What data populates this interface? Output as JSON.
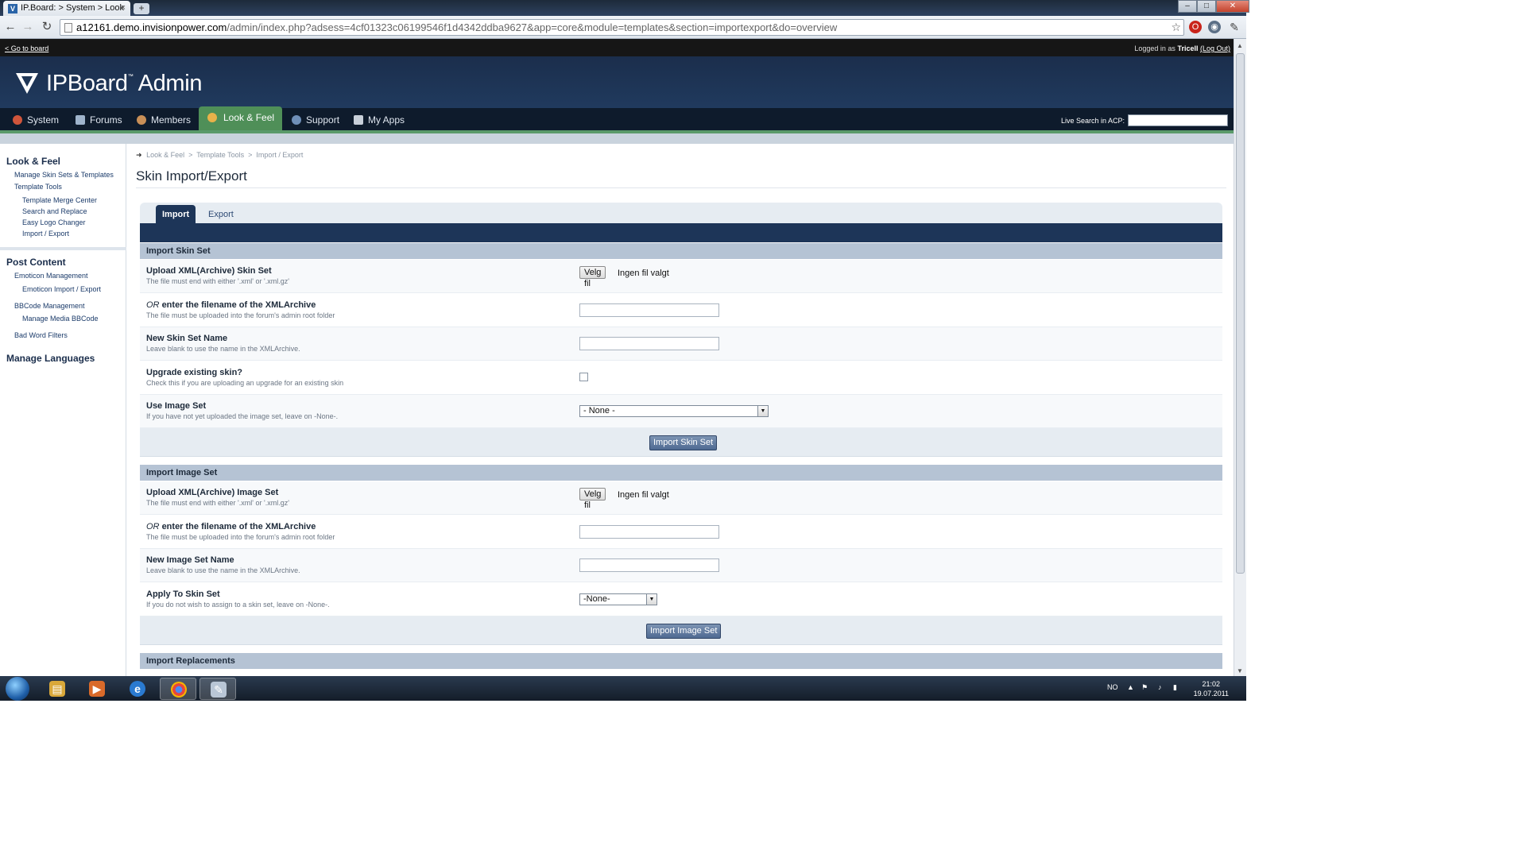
{
  "browser": {
    "tab_title": "IP.Board: > System > Look",
    "tab_close": "×",
    "new_tab": "+",
    "url_host": "a12161.demo.invisionpower.com",
    "url_path": "/admin/index.php?adsess=4cf01323c06199546f1d4342ddba9627&app=core&module=templates&section=importexport&do=overview",
    "win_min": "–",
    "win_max": "□",
    "win_close": "✕"
  },
  "topbar": {
    "go_board": "< Go to board",
    "logged_prefix": "Logged in as",
    "user": "Tricell",
    "logout": "(Log Out)"
  },
  "header": {
    "brand": "IPBoard",
    "tm": "™",
    "brand_suffix": "Admin"
  },
  "nav": {
    "items": [
      "System",
      "Forums",
      "Members",
      "Look & Feel",
      "Support",
      "My Apps"
    ],
    "live_search_label": "Live Search in ACP:"
  },
  "sidebar": {
    "look_feel": "Look & Feel",
    "manage_skin_sets": "Manage Skin Sets & Templates",
    "template_tools": "Template Tools",
    "template_merge": "Template Merge Center",
    "search_replace": "Search and Replace",
    "easy_logo": "Easy Logo Changer",
    "import_export": "Import / Export",
    "post_content": "Post Content",
    "emoticon_mgmt": "Emoticon Management",
    "emoticon_ie": "Emoticon Import / Export",
    "bbcode_mgmt": "BBCode Management",
    "media_bbcode": "Manage Media BBCode",
    "bad_word": "Bad Word Filters",
    "manage_languages": "Manage Languages"
  },
  "main": {
    "breadcrumb": [
      "Look & Feel",
      "Template Tools",
      "Import / Export"
    ],
    "crumb_sep": ">",
    "title": "Skin Import/Export",
    "tabs": [
      "Import",
      "Export"
    ],
    "skin_section": "Import Skin Set",
    "skin_rows": {
      "upload_label": "Upload XML(Archive) Skin Set",
      "upload_desc": "The file must end with either '.xml' or '.xml.gz'",
      "or_prefix": "OR",
      "or_label": "enter the filename of the XMLArchive",
      "or_desc": "The file must be uploaded into the forum's admin root folder",
      "newname_label": "New Skin Set Name",
      "newname_desc": "Leave blank to use the name in the XMLArchive.",
      "upgrade_label": "Upgrade existing skin?",
      "upgrade_desc": "Check this if you are uploading an upgrade for an existing skin",
      "imageset_label": "Use Image Set",
      "imageset_desc": "If you have not yet uploaded the image set, leave on -None-.",
      "imageset_value": "- None -"
    },
    "file_button": "Velg fil",
    "file_status": "Ingen fil valgt",
    "import_skin_btn": "Import Skin Set",
    "image_section": "Import Image Set",
    "image_rows": {
      "upload_label": "Upload XML(Archive) Image Set",
      "upload_desc": "The file must end with either '.xml' or '.xml.gz'",
      "or_prefix": "OR",
      "or_label": "enter the filename of the XMLArchive",
      "or_desc": "The file must be uploaded into the forum's admin root folder",
      "newname_label": "New Image Set Name",
      "newname_desc": "Leave blank to use the name in the XMLArchive.",
      "apply_label": "Apply To Skin Set",
      "apply_desc": "If you do not wish to assign to a skin set, leave on -None-.",
      "apply_value": "-None-"
    },
    "import_image_btn": "Import Image Set",
    "replacements_section": "Import Replacements"
  },
  "taskbar": {
    "lang": "NO",
    "time": "21:02",
    "date": "19.07.2011"
  },
  "colors": {
    "header": "#1b2e4c",
    "nav_active": "#4f8f58",
    "tab_bar": "#1d3558",
    "section_header": "#b5c3d4"
  }
}
